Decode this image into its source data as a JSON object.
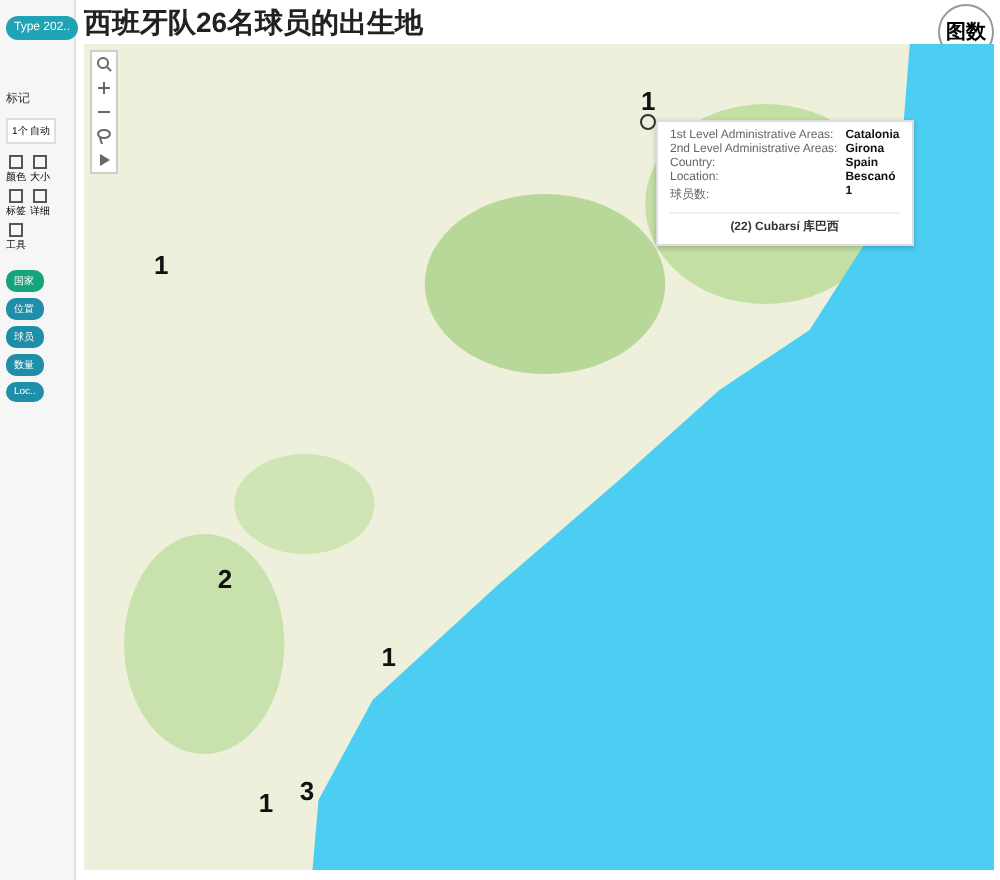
{
  "title": "西班牙队26名球员的出生地",
  "logo": {
    "text": "图数"
  },
  "sidebar": {
    "filter_button": "Type 202..",
    "marks_label": "标记",
    "mark_type": "1个 自动",
    "cards": [
      {
        "label": "颜色"
      },
      {
        "label": "大小"
      },
      {
        "label": "标签"
      },
      {
        "label": "详细"
      },
      {
        "label": "工具"
      }
    ],
    "fields": [
      {
        "label": "国家",
        "color": "#17a37b"
      },
      {
        "label": "位置",
        "color": "#1f8ea8"
      },
      {
        "label": "球员",
        "color": "#1f8ea8"
      },
      {
        "label": "数量",
        "color": "#1f8ea8"
      },
      {
        "label": "Loc..",
        "color": "#1f8ea8"
      }
    ]
  },
  "map": {
    "markers": [
      {
        "label": "1",
        "selected": true
      },
      {
        "label": "1",
        "selected": false
      },
      {
        "label": "2",
        "selected": false
      },
      {
        "label": "1",
        "selected": false
      },
      {
        "label": "1",
        "selected": false
      },
      {
        "label": "3",
        "selected": false
      }
    ],
    "tooltip": {
      "rows": [
        {
          "key": "1st Level Administrative Areas:",
          "value": "Catalonia"
        },
        {
          "key": "2nd Level Administrative Areas:",
          "value": "Girona"
        },
        {
          "key": "Country:",
          "value": "Spain"
        },
        {
          "key": "Location:",
          "value": "Bescanó"
        },
        {
          "key": "球员数:",
          "value": "1"
        }
      ],
      "footer": "(22) Cubarsí 库巴西"
    }
  }
}
